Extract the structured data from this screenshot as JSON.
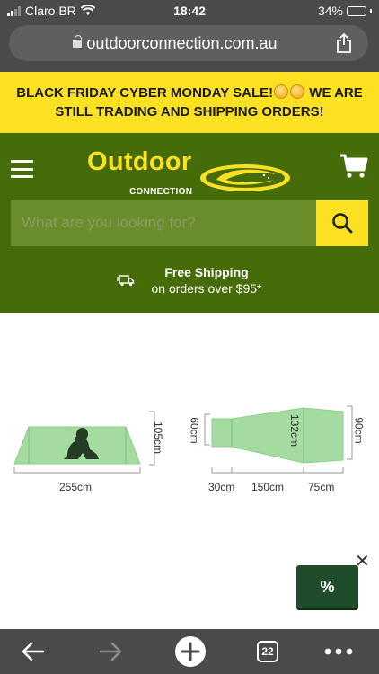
{
  "status_bar": {
    "carrier": "Claro BR",
    "time": "18:42",
    "battery_percent": "34%",
    "battery_level": 0.34
  },
  "browser": {
    "url": "outdoorconnection.com.au",
    "tab_count": "22"
  },
  "promo": {
    "text_line": "BLACK FRIDAY CYBER MONDAY SALE!",
    "text_line2": "WE ARE STILL TRADING AND SHIPPING ORDERS!"
  },
  "header": {
    "logo_word": "Outdoor",
    "logo_sub": "CONNECTION",
    "search_placeholder": "What are you looking for?",
    "shipping_title": "Free Shipping",
    "shipping_sub": "on orders over $95*"
  },
  "tent_diagram": {
    "side_height": "105cm",
    "side_length": "255cm",
    "top_head_width": "60cm",
    "top_mid_width": "132cm",
    "top_foot_width": "90cm",
    "segment_1": "30cm",
    "segment_2": "150cm",
    "segment_3": "75cm"
  },
  "widget": {
    "close_label": "✕",
    "discount_label": "%"
  },
  "colors": {
    "header_green": "#466c0a",
    "promo_yellow": "#fbe122",
    "tent_green": "#a3dba0",
    "widget_green": "#1f4d2b"
  }
}
